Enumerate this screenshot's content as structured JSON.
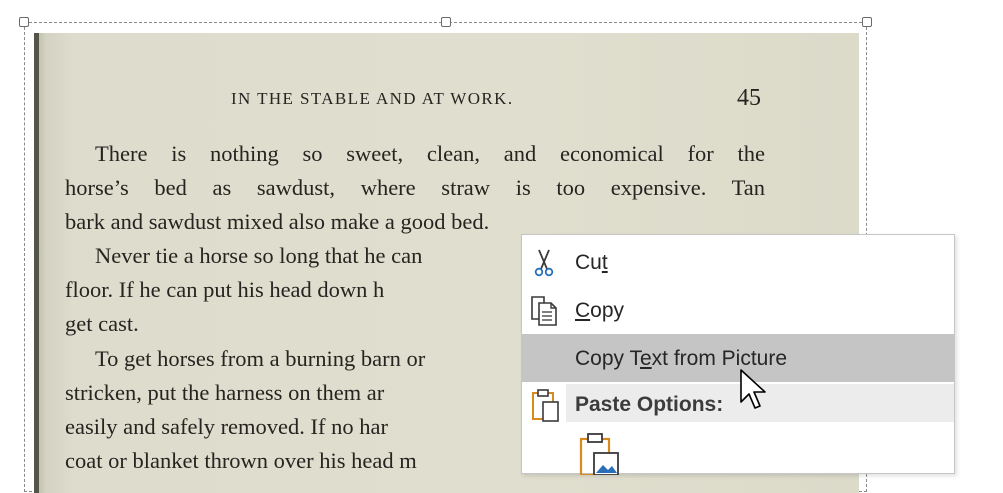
{
  "document": {
    "running_head": "IN THE STABLE AND AT WORK.",
    "page_number": "45",
    "lines": [
      "There is nothing so sweet, clean, and economical for the",
      "horse’s bed as sawdust, where straw is too expensive.   Tan",
      "bark and sawdust mixed also make a good bed.",
      "Never tie a horse so long that he can",
      "floor.   If he can put his head down h",
      "get cast.",
      "To get horses from a burning barn or",
      "stricken, put the harness on them ar",
      "easily and safely removed.   If no har",
      "coat or blanket thrown over his head m"
    ]
  },
  "context_menu": {
    "cut": {
      "pre": "Cu",
      "key": "t",
      "post": "",
      "icon": "scissors-icon"
    },
    "copy": {
      "pre": "",
      "key": "C",
      "post": "opy",
      "icon": "copy-icon"
    },
    "copy_text": {
      "pre": "Copy T",
      "key": "e",
      "post": "xt from Picture"
    },
    "paste_options": {
      "label": "Paste Options:",
      "icon": "clipboard-icon"
    },
    "paste_picture": {
      "icon": "paste-picture-icon"
    }
  },
  "colors": {
    "highlight": "#c5c5c5",
    "section_bg": "#ececec",
    "icon_blue": "#2a6fb8",
    "icon_orange": "#d98a1f"
  }
}
